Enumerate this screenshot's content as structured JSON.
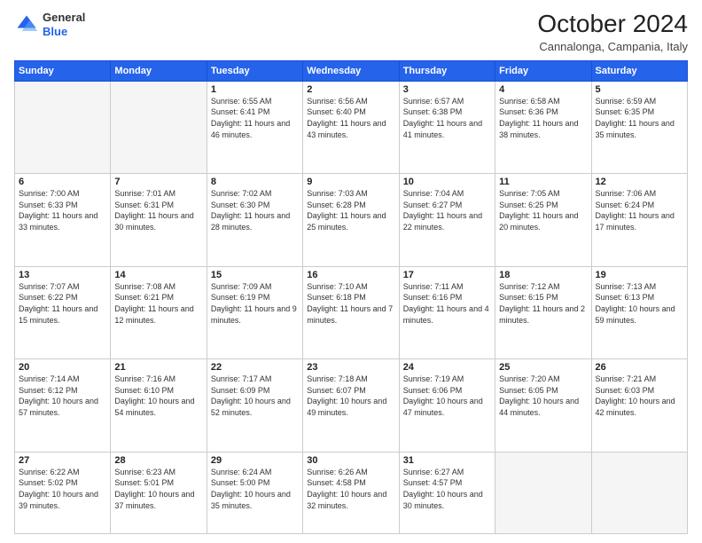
{
  "logo": {
    "general": "General",
    "blue": "Blue"
  },
  "header": {
    "month": "October 2024",
    "location": "Cannalonga, Campania, Italy"
  },
  "weekdays": [
    "Sunday",
    "Monday",
    "Tuesday",
    "Wednesday",
    "Thursday",
    "Friday",
    "Saturday"
  ],
  "weeks": [
    [
      {
        "day": "",
        "sunrise": "",
        "sunset": "",
        "daylight": ""
      },
      {
        "day": "",
        "sunrise": "",
        "sunset": "",
        "daylight": ""
      },
      {
        "day": "1",
        "sunrise": "Sunrise: 6:55 AM",
        "sunset": "Sunset: 6:41 PM",
        "daylight": "Daylight: 11 hours and 46 minutes."
      },
      {
        "day": "2",
        "sunrise": "Sunrise: 6:56 AM",
        "sunset": "Sunset: 6:40 PM",
        "daylight": "Daylight: 11 hours and 43 minutes."
      },
      {
        "day": "3",
        "sunrise": "Sunrise: 6:57 AM",
        "sunset": "Sunset: 6:38 PM",
        "daylight": "Daylight: 11 hours and 41 minutes."
      },
      {
        "day": "4",
        "sunrise": "Sunrise: 6:58 AM",
        "sunset": "Sunset: 6:36 PM",
        "daylight": "Daylight: 11 hours and 38 minutes."
      },
      {
        "day": "5",
        "sunrise": "Sunrise: 6:59 AM",
        "sunset": "Sunset: 6:35 PM",
        "daylight": "Daylight: 11 hours and 35 minutes."
      }
    ],
    [
      {
        "day": "6",
        "sunrise": "Sunrise: 7:00 AM",
        "sunset": "Sunset: 6:33 PM",
        "daylight": "Daylight: 11 hours and 33 minutes."
      },
      {
        "day": "7",
        "sunrise": "Sunrise: 7:01 AM",
        "sunset": "Sunset: 6:31 PM",
        "daylight": "Daylight: 11 hours and 30 minutes."
      },
      {
        "day": "8",
        "sunrise": "Sunrise: 7:02 AM",
        "sunset": "Sunset: 6:30 PM",
        "daylight": "Daylight: 11 hours and 28 minutes."
      },
      {
        "day": "9",
        "sunrise": "Sunrise: 7:03 AM",
        "sunset": "Sunset: 6:28 PM",
        "daylight": "Daylight: 11 hours and 25 minutes."
      },
      {
        "day": "10",
        "sunrise": "Sunrise: 7:04 AM",
        "sunset": "Sunset: 6:27 PM",
        "daylight": "Daylight: 11 hours and 22 minutes."
      },
      {
        "day": "11",
        "sunrise": "Sunrise: 7:05 AM",
        "sunset": "Sunset: 6:25 PM",
        "daylight": "Daylight: 11 hours and 20 minutes."
      },
      {
        "day": "12",
        "sunrise": "Sunrise: 7:06 AM",
        "sunset": "Sunset: 6:24 PM",
        "daylight": "Daylight: 11 hours and 17 minutes."
      }
    ],
    [
      {
        "day": "13",
        "sunrise": "Sunrise: 7:07 AM",
        "sunset": "Sunset: 6:22 PM",
        "daylight": "Daylight: 11 hours and 15 minutes."
      },
      {
        "day": "14",
        "sunrise": "Sunrise: 7:08 AM",
        "sunset": "Sunset: 6:21 PM",
        "daylight": "Daylight: 11 hours and 12 minutes."
      },
      {
        "day": "15",
        "sunrise": "Sunrise: 7:09 AM",
        "sunset": "Sunset: 6:19 PM",
        "daylight": "Daylight: 11 hours and 9 minutes."
      },
      {
        "day": "16",
        "sunrise": "Sunrise: 7:10 AM",
        "sunset": "Sunset: 6:18 PM",
        "daylight": "Daylight: 11 hours and 7 minutes."
      },
      {
        "day": "17",
        "sunrise": "Sunrise: 7:11 AM",
        "sunset": "Sunset: 6:16 PM",
        "daylight": "Daylight: 11 hours and 4 minutes."
      },
      {
        "day": "18",
        "sunrise": "Sunrise: 7:12 AM",
        "sunset": "Sunset: 6:15 PM",
        "daylight": "Daylight: 11 hours and 2 minutes."
      },
      {
        "day": "19",
        "sunrise": "Sunrise: 7:13 AM",
        "sunset": "Sunset: 6:13 PM",
        "daylight": "Daylight: 10 hours and 59 minutes."
      }
    ],
    [
      {
        "day": "20",
        "sunrise": "Sunrise: 7:14 AM",
        "sunset": "Sunset: 6:12 PM",
        "daylight": "Daylight: 10 hours and 57 minutes."
      },
      {
        "day": "21",
        "sunrise": "Sunrise: 7:16 AM",
        "sunset": "Sunset: 6:10 PM",
        "daylight": "Daylight: 10 hours and 54 minutes."
      },
      {
        "day": "22",
        "sunrise": "Sunrise: 7:17 AM",
        "sunset": "Sunset: 6:09 PM",
        "daylight": "Daylight: 10 hours and 52 minutes."
      },
      {
        "day": "23",
        "sunrise": "Sunrise: 7:18 AM",
        "sunset": "Sunset: 6:07 PM",
        "daylight": "Daylight: 10 hours and 49 minutes."
      },
      {
        "day": "24",
        "sunrise": "Sunrise: 7:19 AM",
        "sunset": "Sunset: 6:06 PM",
        "daylight": "Daylight: 10 hours and 47 minutes."
      },
      {
        "day": "25",
        "sunrise": "Sunrise: 7:20 AM",
        "sunset": "Sunset: 6:05 PM",
        "daylight": "Daylight: 10 hours and 44 minutes."
      },
      {
        "day": "26",
        "sunrise": "Sunrise: 7:21 AM",
        "sunset": "Sunset: 6:03 PM",
        "daylight": "Daylight: 10 hours and 42 minutes."
      }
    ],
    [
      {
        "day": "27",
        "sunrise": "Sunrise: 6:22 AM",
        "sunset": "Sunset: 5:02 PM",
        "daylight": "Daylight: 10 hours and 39 minutes."
      },
      {
        "day": "28",
        "sunrise": "Sunrise: 6:23 AM",
        "sunset": "Sunset: 5:01 PM",
        "daylight": "Daylight: 10 hours and 37 minutes."
      },
      {
        "day": "29",
        "sunrise": "Sunrise: 6:24 AM",
        "sunset": "Sunset: 5:00 PM",
        "daylight": "Daylight: 10 hours and 35 minutes."
      },
      {
        "day": "30",
        "sunrise": "Sunrise: 6:26 AM",
        "sunset": "Sunset: 4:58 PM",
        "daylight": "Daylight: 10 hours and 32 minutes."
      },
      {
        "day": "31",
        "sunrise": "Sunrise: 6:27 AM",
        "sunset": "Sunset: 4:57 PM",
        "daylight": "Daylight: 10 hours and 30 minutes."
      },
      {
        "day": "",
        "sunrise": "",
        "sunset": "",
        "daylight": ""
      },
      {
        "day": "",
        "sunrise": "",
        "sunset": "",
        "daylight": ""
      }
    ]
  ]
}
